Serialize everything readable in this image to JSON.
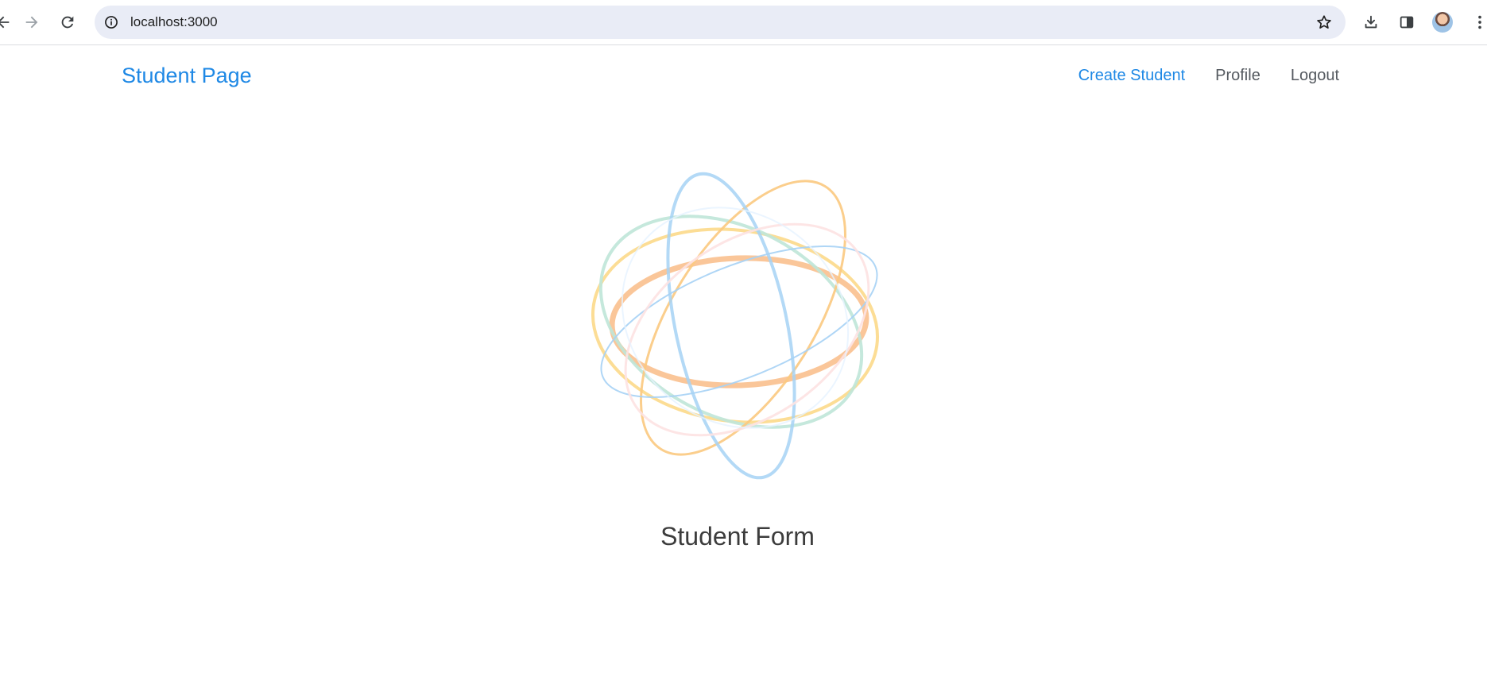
{
  "browser": {
    "url": "localhost:3000",
    "icons": {
      "back": "back-arrow-icon",
      "forward": "forward-arrow-icon",
      "reload": "reload-icon",
      "site_info": "info-icon",
      "bookmark": "star-icon",
      "downloads": "download-icon",
      "side_panel": "side-panel-icon",
      "profile": "avatar",
      "menu": "kebab-menu-icon"
    }
  },
  "navbar": {
    "brand": "Student Page",
    "links": [
      {
        "label": "Create Student",
        "active": true
      },
      {
        "label": "Profile",
        "active": false
      },
      {
        "label": "Logout",
        "active": false
      }
    ]
  },
  "main": {
    "title": "Student Form"
  },
  "colors": {
    "accent": "#1e88e5",
    "nav_text": "#555a60",
    "title_text": "#3c3c3c"
  }
}
